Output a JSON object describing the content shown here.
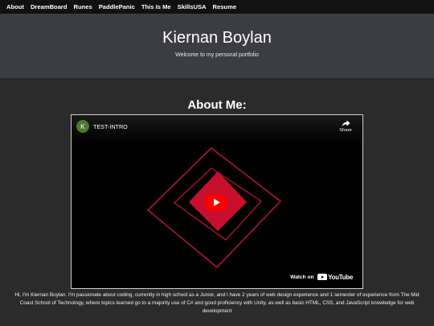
{
  "nav": {
    "items": [
      {
        "label": "About"
      },
      {
        "label": "DreamBoard"
      },
      {
        "label": "Runes"
      },
      {
        "label": "PaddlePanic"
      },
      {
        "label": "This Is Me"
      },
      {
        "label": "SkillsUSA"
      },
      {
        "label": "Resume"
      }
    ]
  },
  "header": {
    "title": "Kiernan Boylan",
    "subtitle": "Welcome to my personal portfolio"
  },
  "about": {
    "heading": "About Me:",
    "video": {
      "channel_initial": "K",
      "title": "TEST-INTRO",
      "share_label": "Share",
      "watch_on_label": "Watch on",
      "youtube_wordmark": "YouTube",
      "icons": [
        "share-icon",
        "play-icon",
        "youtube-logo-icon"
      ],
      "colors": {
        "avatar": "#4a7a2c",
        "accent": "#c8102e",
        "outline": "#b5123a",
        "play": "#ff0000"
      }
    },
    "bio": "Hi, I'm Kiernan Boylan. I'm passionate about coding, currently in high school as a Junior, and I have 2 years of web design experience and 1 semester of experience from The Mid Coast School of Technology, where topics learned go to a majority use of C# and good proficiency with Unity, as well as basic HTML, CSS, and JavaScript knowledge for web development"
  },
  "colors": {
    "page_background": "#2b2b2b",
    "navbar_background": "#111111",
    "header_background": "#3c3d44"
  }
}
